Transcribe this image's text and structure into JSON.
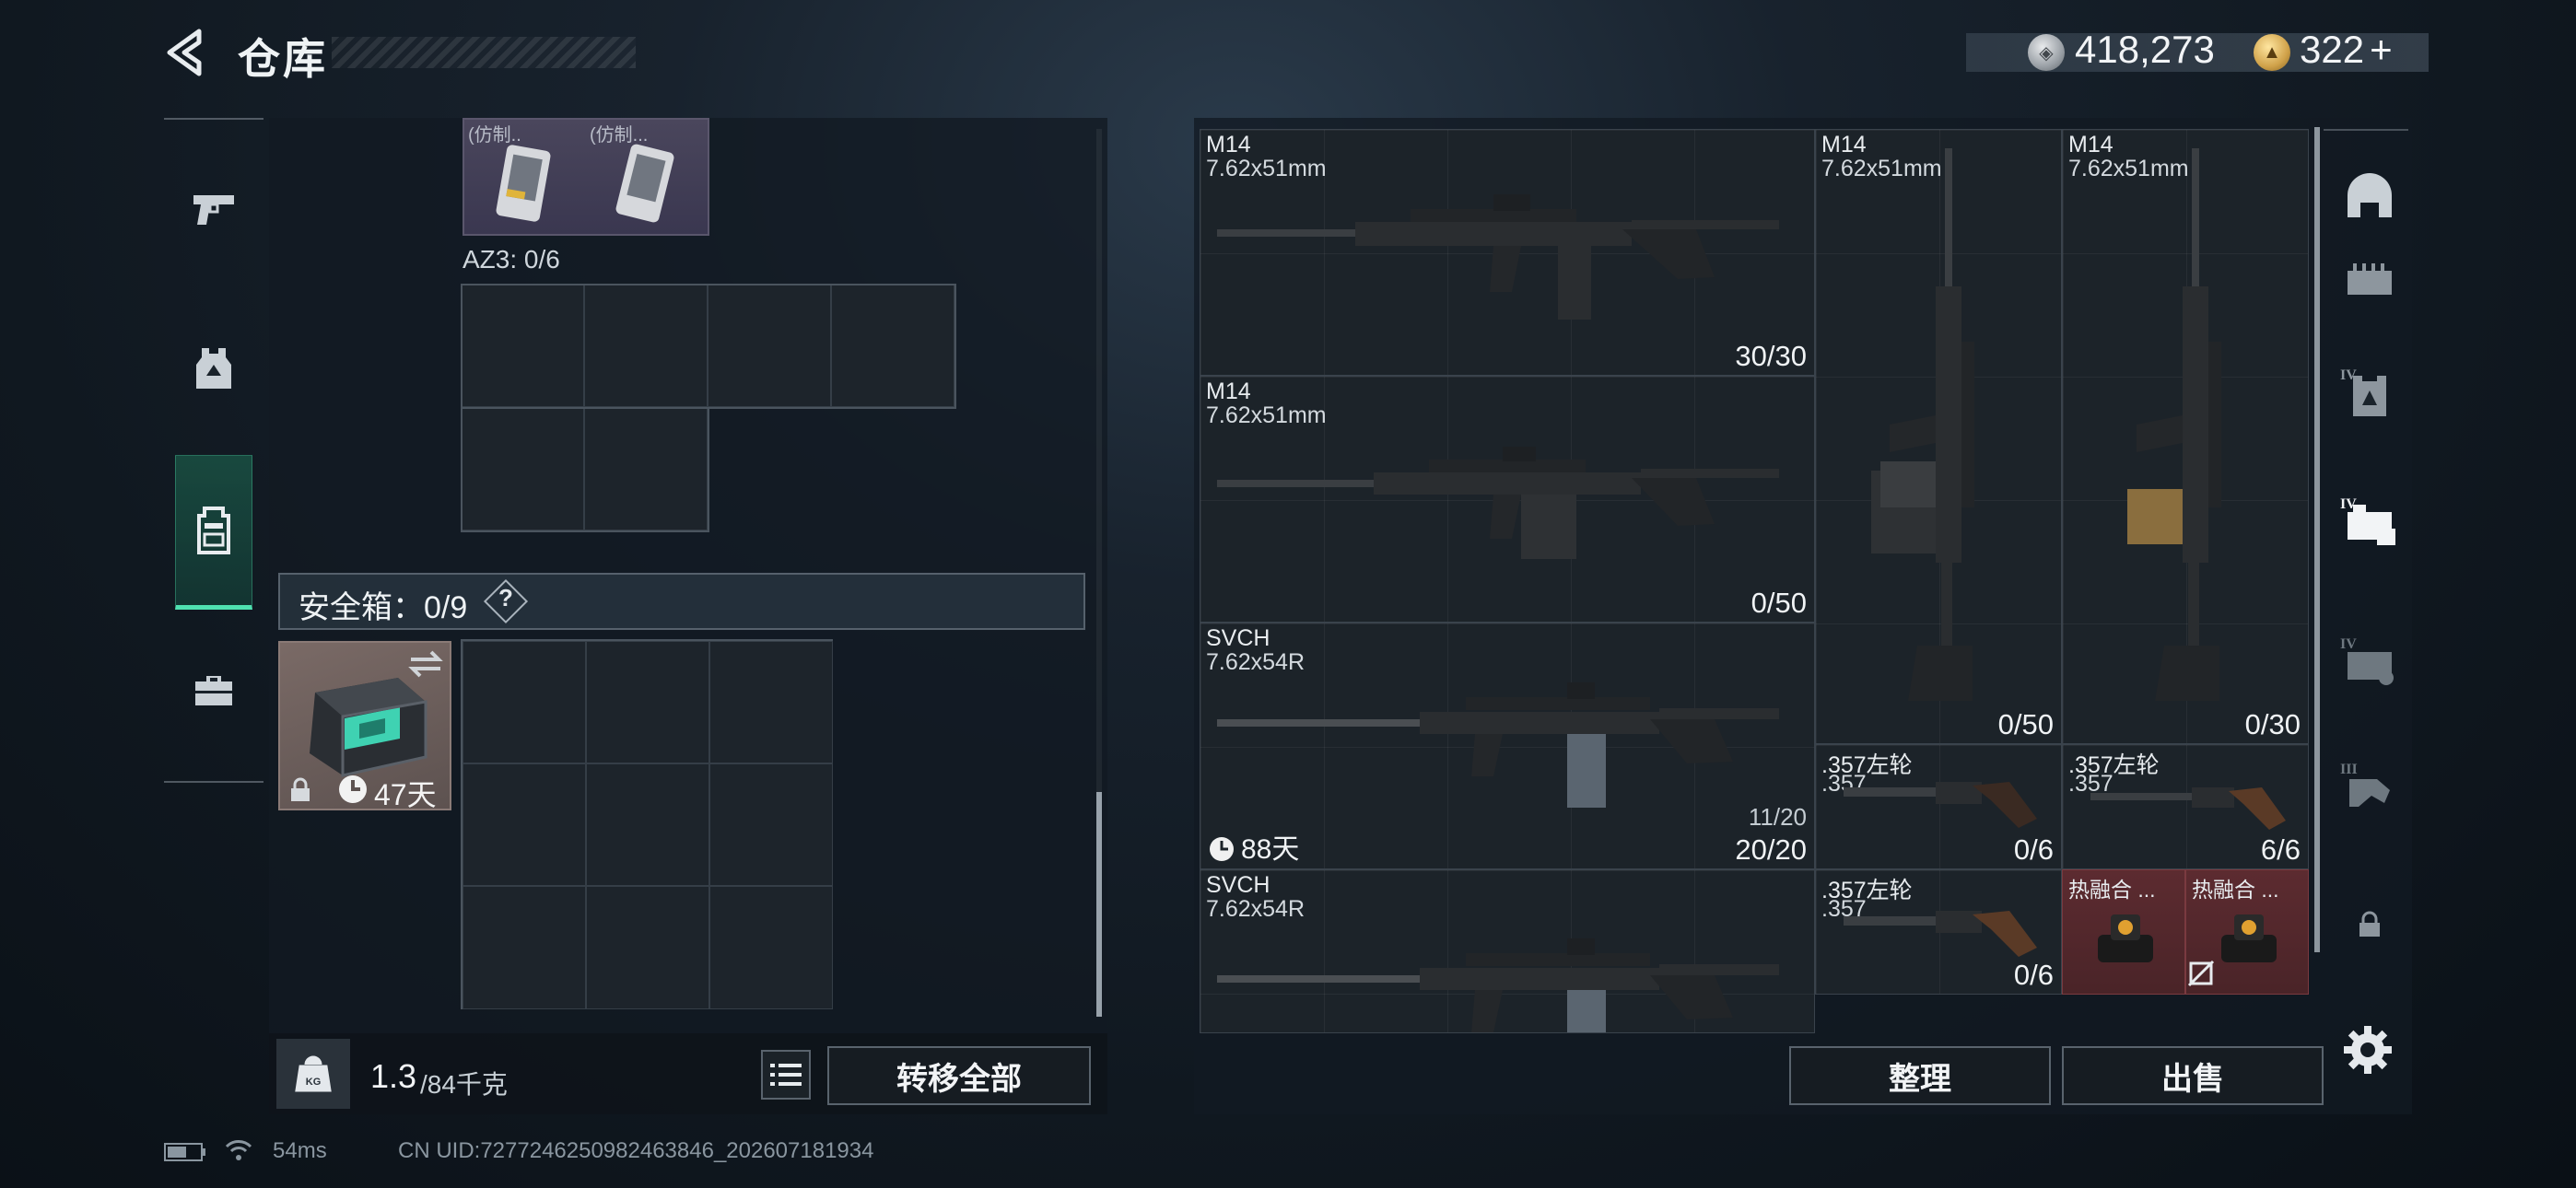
{
  "header": {
    "title": "仓库",
    "silver_amount": "418,273",
    "gold_amount": "322",
    "add_label": "+"
  },
  "left_tabs": [
    {
      "name": "pistol-icon",
      "active": false
    },
    {
      "name": "armor-vest-icon",
      "active": false
    },
    {
      "name": "backpack-icon",
      "active": true
    },
    {
      "name": "toolbox-icon",
      "active": false
    }
  ],
  "left_panel": {
    "top_items": [
      {
        "label": "(\u0010份制\u0010...",
        "display": "(\u0010仿制\u0010..."
      },
      {
        "label": "(\u0010仿制\u0010...",
        "display": "(\u0010仿制\u0010..."
      }
    ],
    "top_item_labels": [
      "(仿制..",
      "(仿制..."
    ],
    "az_label": "AZ3: 0/6",
    "safe_box_label": "安全箱：0/9",
    "safe_box_help": "?",
    "safe_case_days": "47天",
    "weight_current": "1.3",
    "weight_max": "/84千克",
    "weight_icon_text": "KG",
    "transfer_all_label": "转移全部"
  },
  "stash_items": [
    {
      "name": "M14",
      "caliber": "7.62x51mm",
      "count": "30/30"
    },
    {
      "name": "M14",
      "caliber": "7.62x51mm",
      "count": "0/50"
    },
    {
      "name": "M14",
      "caliber": "7.62x51mm",
      "count": "0/30"
    },
    {
      "name": "M14",
      "caliber": "7.62x51mm",
      "count": "0/50"
    },
    {
      "name": "SVCH",
      "caliber": "7.62x54R",
      "count": "20/20",
      "sub": "11/20",
      "days": "88天"
    },
    {
      "name": ".357左轮",
      "caliber": ".357",
      "count": "0/6"
    },
    {
      "name": ".357左轮",
      "caliber": ".357",
      "count": "6/6"
    },
    {
      "name": "SVCH",
      "caliber": "7.62x54R",
      "count": ""
    },
    {
      "name": ".357左轮",
      "caliber": ".357",
      "count": "0/6"
    },
    {
      "name": "热融合 ...",
      "caliber": "",
      "count": ""
    },
    {
      "name": "热融合 ...",
      "caliber": "",
      "count": ""
    }
  ],
  "buttons": {
    "sort_label": "整理",
    "sell_label": "出售"
  },
  "right_tabs": [
    {
      "name": "helmet-icon",
      "level": ""
    },
    {
      "name": "ammo-box-icon",
      "level": ""
    },
    {
      "name": "armor-icon",
      "level": "IV"
    },
    {
      "name": "rig-icon",
      "level": "IV"
    },
    {
      "name": "rig-alt-icon",
      "level": "IV"
    },
    {
      "name": "gloves-icon",
      "level": "III"
    },
    {
      "name": "lock-icon",
      "level": ""
    }
  ],
  "footer": {
    "ping": "54ms",
    "uid": "CN UID:7277246250982463846_202607181934"
  },
  "colors": {
    "accent": "#4fe0b0",
    "panel": "#121a22",
    "item_red": "#5c2b30"
  }
}
